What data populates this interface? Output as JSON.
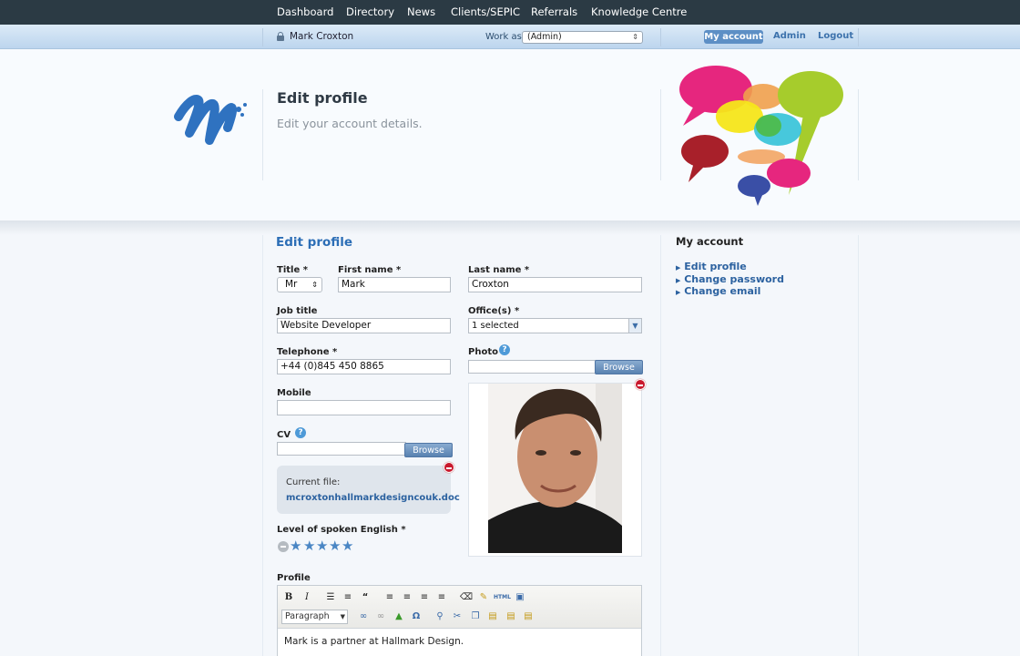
{
  "topnav": {
    "items": [
      "Dashboard",
      "Directory",
      "News",
      "Clients/SEPIC",
      "Referrals",
      "Knowledge Centre"
    ]
  },
  "userbar": {
    "user": "Mark Croxton",
    "work_as_label": "Work as",
    "work_as_value": "(Admin)",
    "my_account": "My account",
    "admin": "Admin",
    "logout": "Logout"
  },
  "header": {
    "title": "Edit profile",
    "subtitle": "Edit your account details."
  },
  "form": {
    "heading": "Edit profile",
    "title_label": "Title *",
    "title_value": "Mr",
    "first_name_label": "First name *",
    "first_name_value": "Mark",
    "last_name_label": "Last name *",
    "last_name_value": "Croxton",
    "job_title_label": "Job title",
    "job_title_value": "Website Developer",
    "offices_label": "Office(s) *",
    "offices_value": "1 selected",
    "telephone_label": "Telephone *",
    "telephone_value": "+44 (0)845 450 8865",
    "photo_label": "Photo",
    "mobile_label": "Mobile",
    "mobile_value": "",
    "cv_label": "CV",
    "browse": "Browse",
    "current_file_label": "Current file:",
    "current_file_name": "mcroxtonhallmarkdesigncouk.doc",
    "english_label": "Level of spoken English *",
    "english_rating": 5,
    "english_max": 5,
    "profile_label": "Profile",
    "format_select": "Paragraph",
    "profile_text": "Mark is a partner at Hallmark Design."
  },
  "sidebar": {
    "title": "My account",
    "links": [
      "Edit profile",
      "Change password",
      "Change email"
    ]
  },
  "colors": {
    "nav_bg": "#2b3a44",
    "accent": "#2c62a0",
    "button": "#5982b1"
  }
}
